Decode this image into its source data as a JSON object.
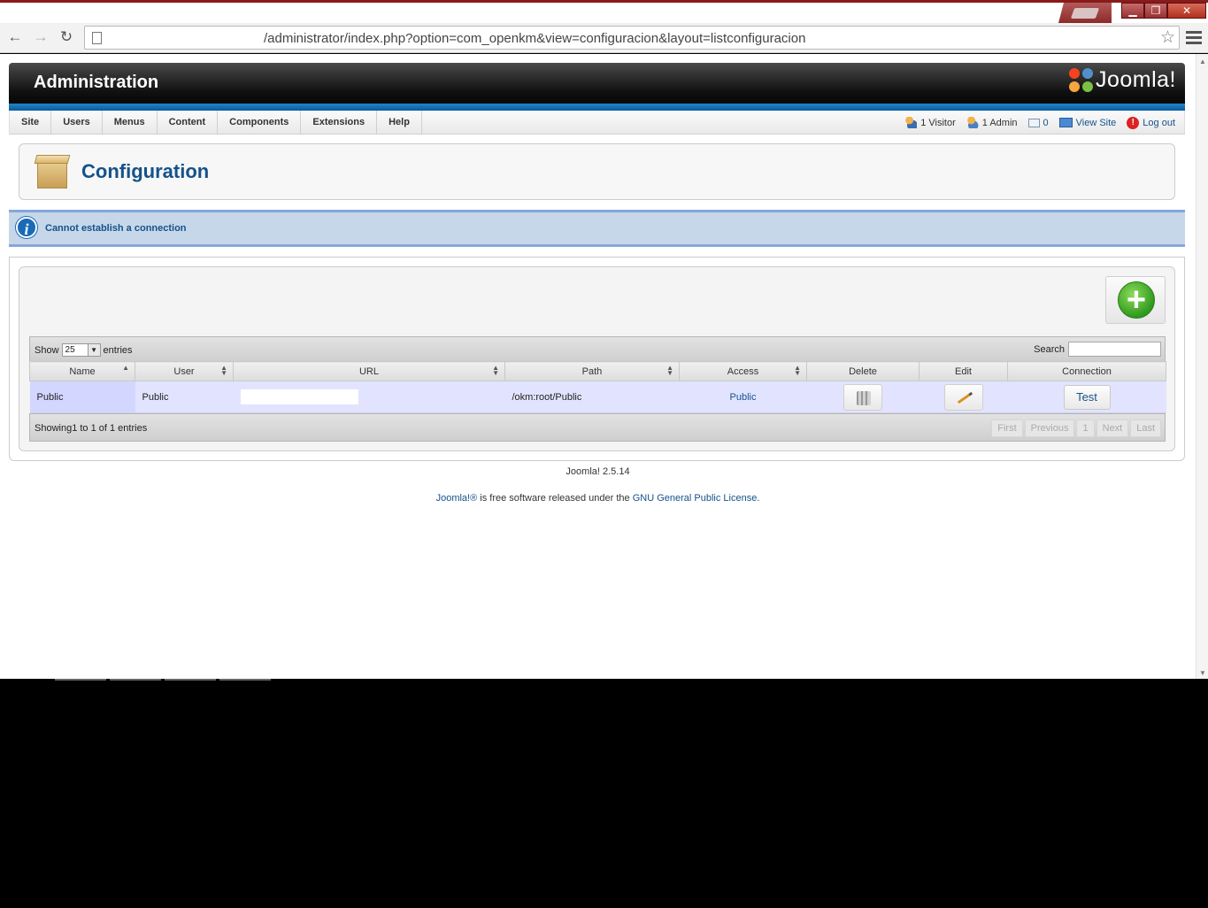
{
  "browser": {
    "url": "/administrator/index.php?option=com_openkm&view=configuracion&layout=listconfiguracion",
    "window_buttons": {
      "minimize": "▁",
      "maximize": "❐",
      "close": "✕"
    }
  },
  "header": {
    "title": "Administration",
    "logo_text": "Joomla!"
  },
  "menu": {
    "items": [
      "Site",
      "Users",
      "Menus",
      "Content",
      "Components",
      "Extensions",
      "Help"
    ]
  },
  "status": {
    "visitors": "1 Visitor",
    "admins": "1 Admin",
    "messages": "0",
    "view_site": "View Site",
    "logout": "Log out"
  },
  "page": {
    "title": "Configuration"
  },
  "message": {
    "text": "Cannot establish a connection"
  },
  "table_controls": {
    "show_label": "Show",
    "page_size": "25",
    "entries_label": "entries",
    "search_label": "Search",
    "search_value": ""
  },
  "table": {
    "columns": [
      "Name",
      "User",
      "URL",
      "Path",
      "Access",
      "Delete",
      "Edit",
      "Connection"
    ],
    "rows": [
      {
        "name": "Public",
        "user": "Public",
        "url": "",
        "path": "/okm:root/Public",
        "access": "Public",
        "connection": "Test"
      }
    ]
  },
  "table_footer": {
    "info": "Showing1 to 1 of 1 entries",
    "pager": [
      "First",
      "Previous",
      "1",
      "Next",
      "Last"
    ]
  },
  "footer": {
    "version": "Joomla! 2.5.14",
    "license_link": "Joomla!®",
    "license_text": " is free software released under the ",
    "license_name": "GNU General Public License",
    "license_end": "."
  },
  "colors": {
    "accent_blue": "#15528a",
    "header_blue_bar": "#1f86c8",
    "message_bg": "#c6d7ea",
    "row_bg": "#e2e4ff",
    "add_green": "#2f9a1e"
  }
}
